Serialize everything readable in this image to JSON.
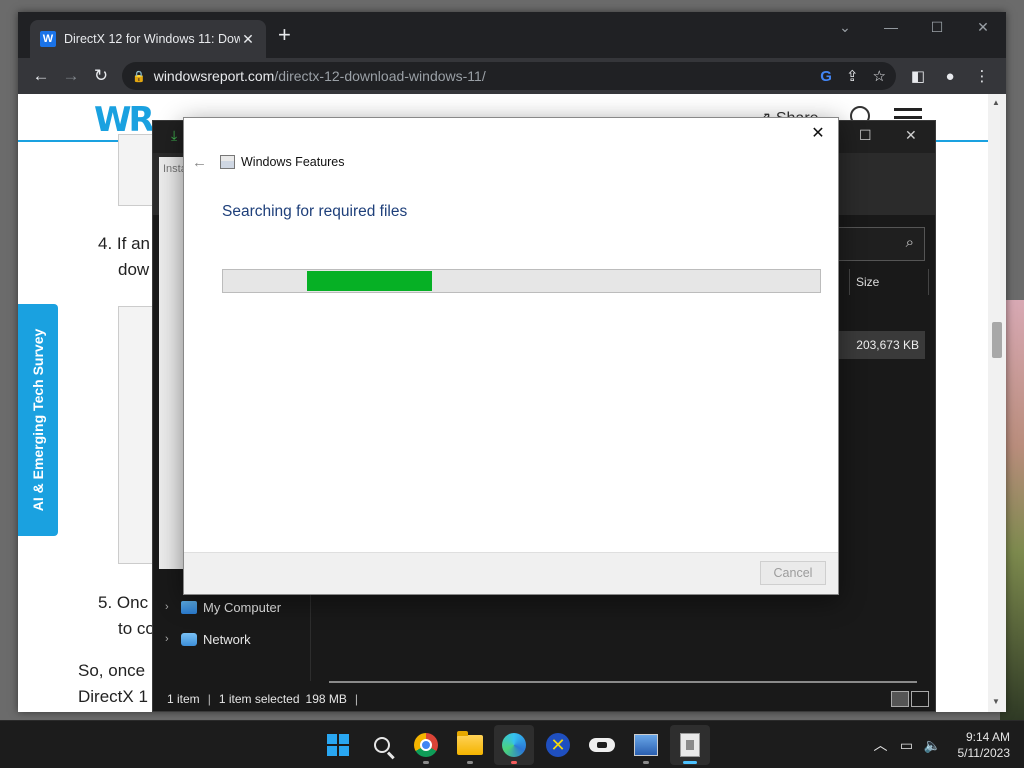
{
  "browser": {
    "tab_title": "DirectX 12 for Windows 11: Dow",
    "tab_favicon": "W",
    "url_host": "windowsreport.com",
    "url_path": "/directx-12-download-windows-11/"
  },
  "website": {
    "logo": "WR",
    "share_label": "Share",
    "survey_label": "AI & Emerging Tech Survey",
    "step4_line1": "4. If an",
    "step4_line2": "dow",
    "step5_line1": "5. Onc",
    "step5_line2": "to co",
    "para_line1": "So, once",
    "para_line2": "DirectX 1",
    "thumb_text": "Insta"
  },
  "explorer": {
    "size_header": "Size",
    "file_size": "203,673 KB",
    "nav_items": [
      "My Computer",
      "Network"
    ],
    "status_items": "1 item",
    "status_selected": "1 item selected",
    "status_size": "198 MB"
  },
  "dialog": {
    "title": "Windows Features",
    "heading": "Searching for required files",
    "cancel_label": "Cancel",
    "progress": {
      "start": 0.14,
      "end": 0.35
    }
  },
  "taskbar": {
    "time": "9:14 AM",
    "date": "5/11/2023"
  },
  "colors": {
    "accent": "#1aa1e0",
    "progress": "#06b025",
    "heading": "#1e3f7a"
  }
}
